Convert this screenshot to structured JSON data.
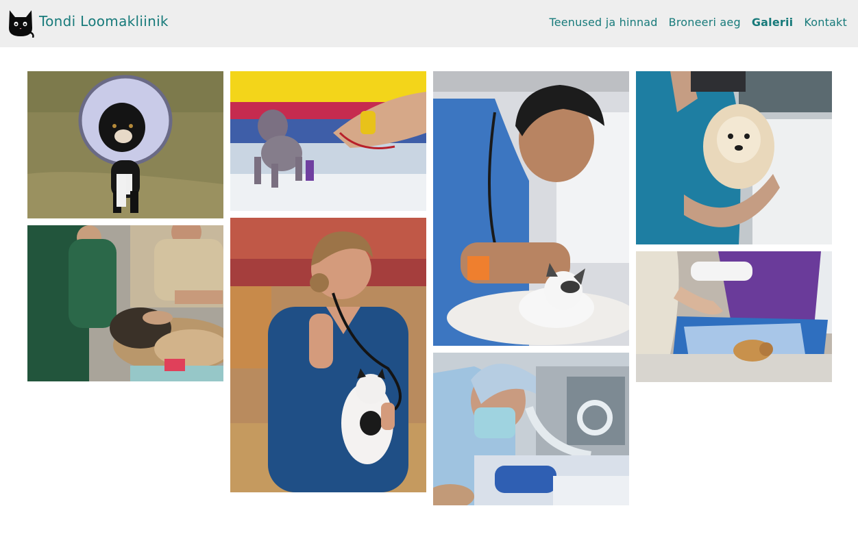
{
  "header": {
    "brand": "Tondi Loomakliinik",
    "logo": "black-cat-icon",
    "nav": [
      {
        "label": "Teenused ja hinnad",
        "active": false
      },
      {
        "label": "Broneeri aeg",
        "active": false
      },
      {
        "label": "Galerii",
        "active": true
      },
      {
        "label": "Kontakt",
        "active": false
      }
    ]
  },
  "gallery": {
    "photos": [
      {
        "subject": "dog-with-cone"
      },
      {
        "subject": "puppy-checkup"
      },
      {
        "subject": "vet-with-kitten"
      },
      {
        "subject": "vet-holding-dog"
      },
      {
        "subject": "vets-examining-dog"
      },
      {
        "subject": "vet-with-stethoscope-cat"
      },
      {
        "subject": "surgery"
      },
      {
        "subject": "cat-on-table"
      }
    ]
  },
  "colors": {
    "header_bg": "#eeeeee",
    "link": "#177a7a"
  }
}
